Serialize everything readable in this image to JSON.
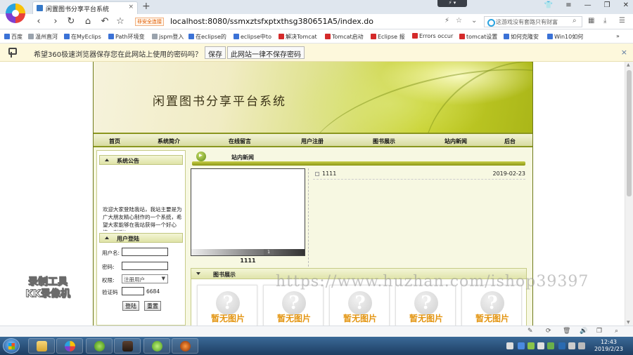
{
  "browser": {
    "tab_title": "闲置图书分享平台系统",
    "tab_close": "×",
    "new_tab": "+",
    "flash_badge": "⚡ ▾",
    "secure_tag": "非安全连接",
    "url_host": "localhost",
    "url_rest": ":8080/ssmxztsfxptxthsg380651A5/index.do",
    "search_placeholder": "这游戏没有套路只有财富",
    "bookmarks": [
      "百度",
      "温州直河",
      "在MyEclips",
      "Path环境变",
      "jspm登入",
      "在eclipse的",
      "eclipse中to",
      "解决Tomcat",
      "Tomcat启动",
      "Eclipse 报",
      "Errors occur",
      "tomcat设置",
      "如何克隆安",
      "Win10如何"
    ],
    "bookmark_more": "»"
  },
  "password_bar": {
    "text": "希望360极速浏览器保存您在此网站上使用的密码吗？",
    "save_label": "保存",
    "never_label": "此网站一律不保存密码",
    "close": "×"
  },
  "site": {
    "title": "闲置图书分享平台系统",
    "nav": [
      "首页",
      "系统简介",
      "在线留言",
      "用户注册",
      "图书展示",
      "站内新闻",
      "后台"
    ],
    "notice_head": "系统公告",
    "notice_text": "欢迎大家登陆我站，我站主要是为广大朋友精心制作的一个系统，希望大家能够在我站获得一个好心情，谢谢！",
    "login_head": "用户登陆",
    "login": {
      "username_label": "用户名:",
      "password_label": "密码:",
      "role_label": "权限:",
      "role_value": "注册用户",
      "captcha_label": "验证码",
      "captcha_code": "6684",
      "login_button": "登陆",
      "reset_button": "重置"
    },
    "news_head": "站内新闻",
    "photo_caption": "1111",
    "photo_page": "1",
    "news_items": [
      {
        "title": "1111",
        "date": "2019-02-23"
      }
    ],
    "books_head": "图书展示",
    "book_placeholder": "暂无图片",
    "book_count": 5
  },
  "watermark": "https://www.huzhan.com/ishop39397",
  "overlay_logo": [
    "录制工具",
    "KK录像机"
  ],
  "taskbar": {
    "time": "12:43",
    "date": "2019/2/23"
  }
}
